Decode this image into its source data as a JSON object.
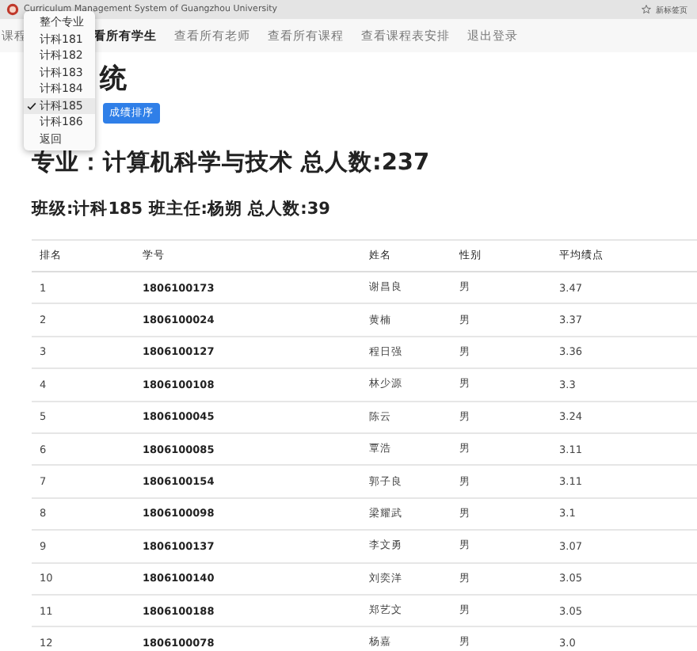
{
  "browser": {
    "title": "Curriculum Management System of Guangzhou University",
    "bookmark": "新标签页"
  },
  "nav": [
    {
      "label": "课程",
      "selected": false
    },
    {
      "label": "看所有学生",
      "selected": true
    },
    {
      "label": "查看所有老师",
      "selected": false
    },
    {
      "label": "查看所有课程",
      "selected": false
    },
    {
      "label": "查看课程表安排",
      "selected": false
    },
    {
      "label": "退出登录",
      "selected": false
    }
  ],
  "dropdown": [
    {
      "label": "整个专业",
      "selected": false
    },
    {
      "label": "计科181",
      "selected": false
    },
    {
      "label": "计科182",
      "selected": false
    },
    {
      "label": "计科183",
      "selected": false
    },
    {
      "label": "计科184",
      "selected": false
    },
    {
      "label": "计科185",
      "selected": true
    },
    {
      "label": "计科186",
      "selected": false
    },
    {
      "label": "返回",
      "selected": false
    }
  ],
  "title": "统",
  "sort_button": "成绩排序",
  "major_heading": "专业：计算机科学与技术 总人数:237",
  "class_heading": "班级:计科185 班主任:杨朔 总人数:39",
  "table": {
    "columns": [
      "排名",
      "学号",
      "姓名",
      "性别",
      "平均绩点"
    ],
    "rows": [
      [
        "1",
        "1806100173",
        "谢昌良",
        "男",
        "3.47"
      ],
      [
        "2",
        "1806100024",
        "黄楠",
        "男",
        "3.37"
      ],
      [
        "3",
        "1806100127",
        "程日强",
        "男",
        "3.36"
      ],
      [
        "4",
        "1806100108",
        "林少源",
        "男",
        "3.3"
      ],
      [
        "5",
        "1806100045",
        "陈云",
        "男",
        "3.24"
      ],
      [
        "6",
        "1806100085",
        "覃浩",
        "男",
        "3.11"
      ],
      [
        "7",
        "1806100154",
        "郭子良",
        "男",
        "3.11"
      ],
      [
        "8",
        "1806100098",
        "梁耀武",
        "男",
        "3.1"
      ],
      [
        "9",
        "1806100137",
        "李文勇",
        "男",
        "3.07"
      ],
      [
        "10",
        "1806100140",
        "刘奕洋",
        "男",
        "3.05"
      ],
      [
        "11",
        "1806100188",
        "郑艺文",
        "男",
        "3.05"
      ],
      [
        "12",
        "1806100078",
        "杨嘉",
        "男",
        "3.0"
      ]
    ]
  }
}
